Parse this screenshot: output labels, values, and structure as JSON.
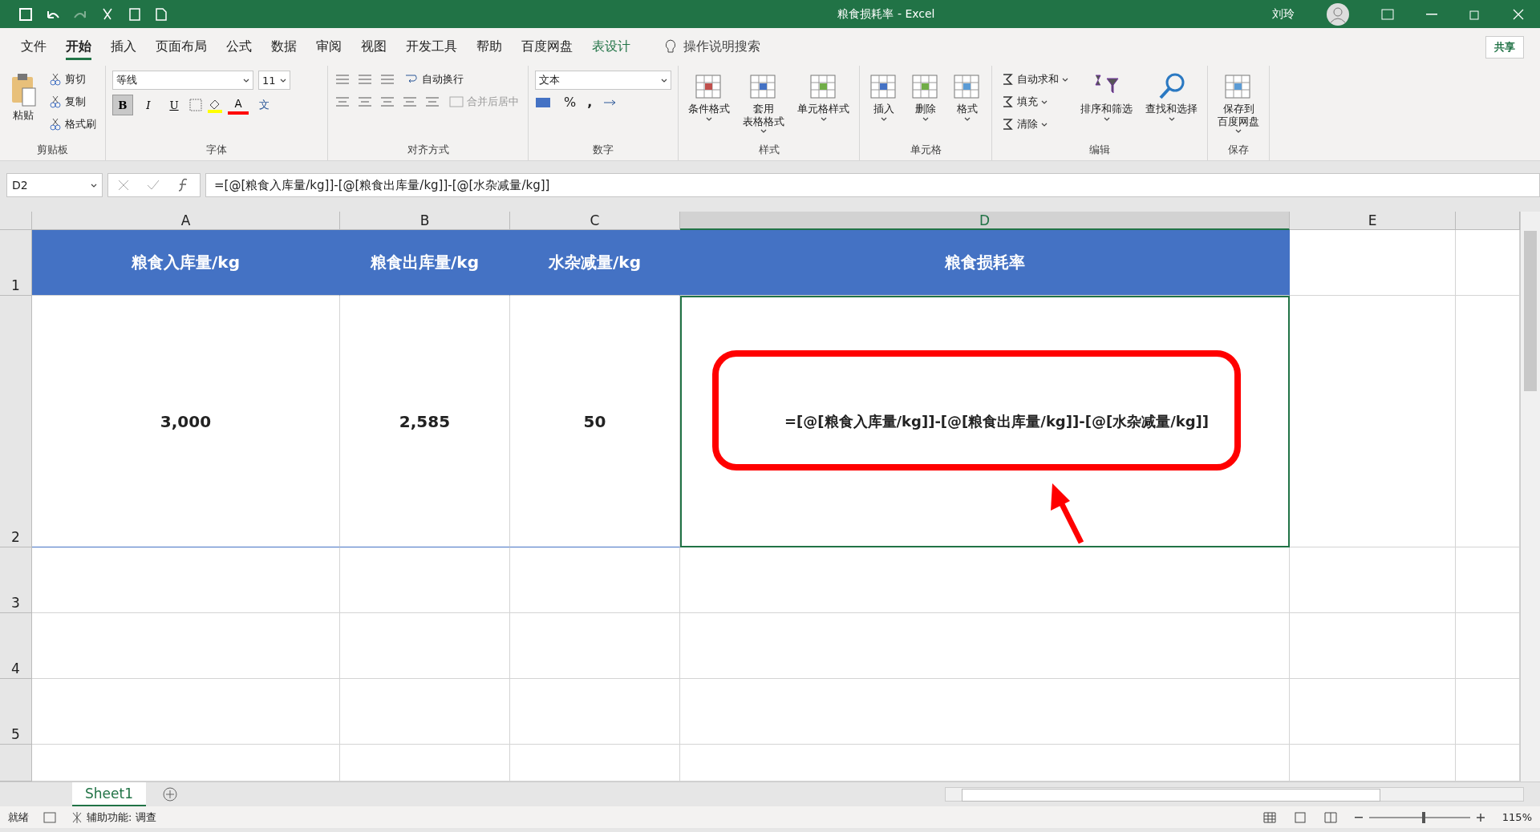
{
  "window": {
    "title": "粮食损耗率  -  Excel",
    "user": "刘玲"
  },
  "menu_tabs": [
    {
      "label": "文件",
      "selected": false
    },
    {
      "label": "开始",
      "selected": true
    },
    {
      "label": "插入",
      "selected": false
    },
    {
      "label": "页面布局",
      "selected": false
    },
    {
      "label": "公式",
      "selected": false
    },
    {
      "label": "数据",
      "selected": false
    },
    {
      "label": "审阅",
      "selected": false
    },
    {
      "label": "视图",
      "selected": false
    },
    {
      "label": "开发工具",
      "selected": false
    },
    {
      "label": "帮助",
      "selected": false
    },
    {
      "label": "百度网盘",
      "selected": false
    },
    {
      "label": "表设计",
      "selected": false,
      "kind": "context"
    }
  ],
  "tell_me": "操作说明搜索",
  "share": "共享",
  "ribbon": [
    {
      "kind": "clipboard",
      "label": "剪贴板",
      "paste": "粘贴",
      "items": [
        "剪切",
        "复制",
        "格式刷"
      ]
    },
    {
      "kind": "font",
      "label": "字体",
      "font_name": "等线",
      "font_size": "11",
      "bold": "B",
      "italic": "I",
      "underline": "U",
      "font_color": "A",
      "phonetic": "文"
    },
    {
      "kind": "align",
      "label": "对齐方式",
      "wrap": "自动换行",
      "merge": "合并后居中"
    },
    {
      "kind": "number",
      "label": "数字",
      "format": "文本",
      "percent": "%",
      "comma": ","
    },
    {
      "kind": "large",
      "label": "样式",
      "items": [
        [
          "条件格式"
        ],
        [
          "套用",
          "表格格式"
        ],
        [
          "单元格样式"
        ]
      ]
    },
    {
      "kind": "large",
      "label": "单元格",
      "items": [
        [
          "插入"
        ],
        [
          "删除"
        ],
        [
          "格式"
        ]
      ]
    },
    {
      "kind": "edit",
      "label": "编辑",
      "items": [
        "自动求和",
        "填充",
        "清除"
      ],
      "large": [
        "排序和筛选",
        "查找和选择"
      ]
    },
    {
      "kind": "large",
      "label": "保存",
      "items": [
        [
          "保存到",
          "百度网盘"
        ]
      ]
    }
  ],
  "name_box": "D2",
  "formula": "=[@[粮食入库量/kg]]-[@[粮食出库量/kg]]-[@[水杂减量/kg]]",
  "columns": [
    {
      "label": "A",
      "selected": false
    },
    {
      "label": "B",
      "selected": false
    },
    {
      "label": "C",
      "selected": false
    },
    {
      "label": "D",
      "selected": true
    },
    {
      "label": "E",
      "selected": false
    }
  ],
  "rows": [
    {
      "number": "1",
      "kind": "header",
      "cells": [
        "粮食入库量/kg",
        "粮食出库量/kg",
        "水杂减量/kg",
        "粮食损耗率"
      ]
    },
    {
      "number": "2",
      "kind": "data",
      "cells": [
        "3,000",
        "2,585",
        "50",
        "=[@[粮食入库量/kg]]-[@[粮食出库量/kg]]-[@[水杂减量/kg]]"
      ]
    },
    {
      "number": "3",
      "kind": "empty",
      "cells": []
    },
    {
      "number": "4",
      "kind": "empty",
      "cells": []
    },
    {
      "number": "5",
      "kind": "empty",
      "cells": []
    }
  ],
  "sheet_tab": "Sheet1",
  "status": {
    "ready": "就绪",
    "accessibility": "辅助功能: 调查",
    "zoom": "115%",
    "zoom_slider": {
      "level": 0.55
    }
  }
}
